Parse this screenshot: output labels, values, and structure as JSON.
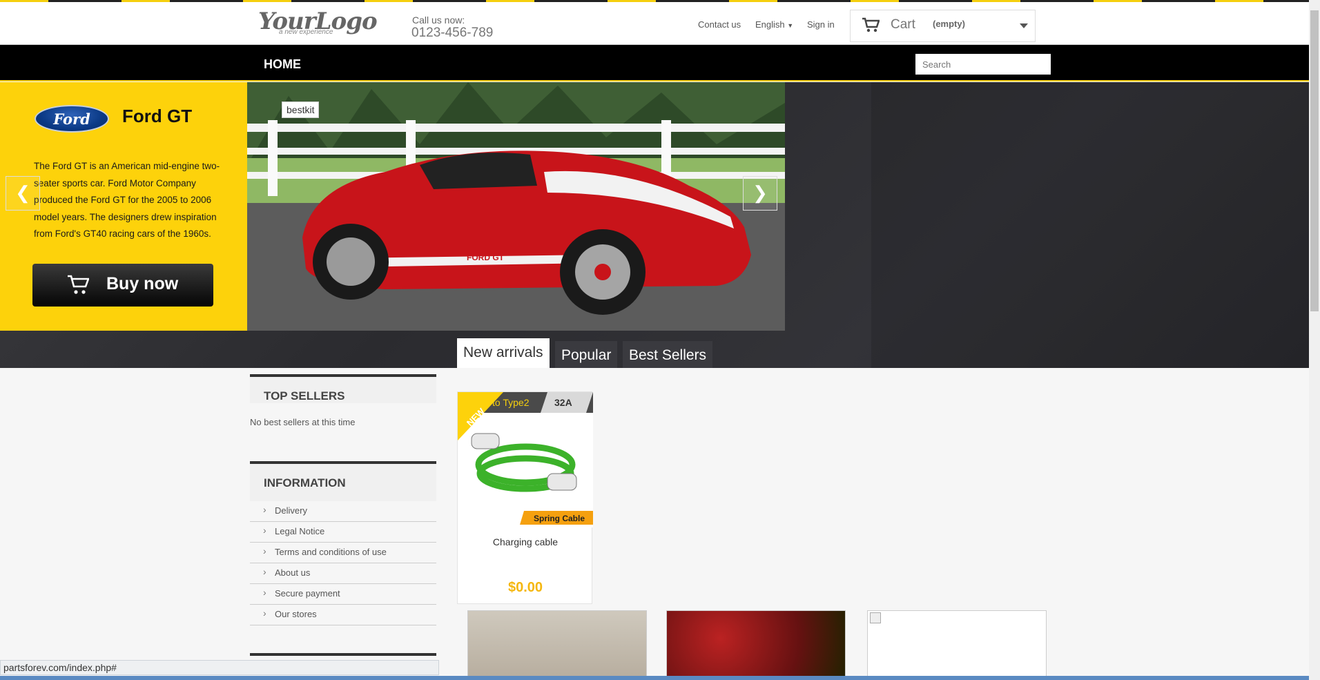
{
  "header": {
    "logo_text": "YourLogo",
    "logo_tagline": "a new experience",
    "call_label": "Call us now:",
    "phone": "0123-456-789",
    "contact": "Contact us",
    "language": "English",
    "signin": "Sign in",
    "cart_label": "Cart",
    "cart_status": "(empty)"
  },
  "nav": {
    "home": "HOME",
    "search_placeholder": "Search"
  },
  "slider": {
    "brand_logo": "Ford",
    "title": "Ford GT",
    "description": "The Ford GT is an American mid-engine two-seater sports car. Ford Motor Company produced the Ford GT for the 2005 to 2006 model years. The designers drew inspiration from Ford's GT40 racing cars of the 1960s.",
    "buy_label": "Buy now",
    "image_tag": "bestkit",
    "car_badge": "FORD GT"
  },
  "tabs": [
    {
      "label": "New arrivals"
    },
    {
      "label": "Popular"
    },
    {
      "label": "Best Sellers"
    }
  ],
  "sidebar": {
    "top_sellers_title": "TOP SELLERS",
    "top_sellers_empty": "No best sellers at this time",
    "information_title": "INFORMATION",
    "info_items": [
      {
        "label": "Delivery"
      },
      {
        "label": "Legal Notice"
      },
      {
        "label": "Terms and conditions of use"
      },
      {
        "label": "About us"
      },
      {
        "label": "Secure payment"
      },
      {
        "label": "Our stores"
      }
    ]
  },
  "product": {
    "badge": "NEW",
    "banner_text": "Type1 to Type2",
    "amp": "32A",
    "ribbon": "Spring Cable",
    "name": "Charging cable",
    "price": "$0.00"
  },
  "status_url": "partsforev.com/index.php#",
  "colors": {
    "accent": "#fdd20b",
    "price": "#f5b70f"
  }
}
